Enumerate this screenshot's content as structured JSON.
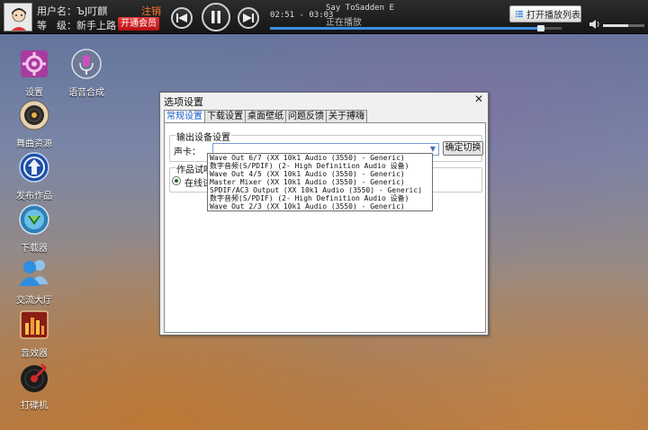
{
  "top_bar": {
    "username_label": "用户名：",
    "username": "ЪJ叮麒",
    "level_label": "等　级：",
    "level": "新手上路",
    "logout": "注销",
    "vip_button": "开通会员",
    "time_current": "02:51",
    "time_separator": " - ",
    "time_total": "03:03",
    "song_title": "Say ToSadden E",
    "play_status": "正在播放",
    "progress_fraction": 0.94,
    "playlist_button": "打开播放列表",
    "volume_fraction": 0.6,
    "colors": {
      "accent": "#3d8fe0",
      "vip": "#d42426",
      "logout": "#ff7a2a"
    }
  },
  "desktop_icons": [
    {
      "label": "设置",
      "icon": "settings-icon"
    },
    {
      "label": "语音合成",
      "icon": "microphone-icon"
    },
    {
      "label": "舞曲资源",
      "icon": "vinyl-disc-icon"
    },
    {
      "label": "发布作品",
      "icon": "upload-icon"
    },
    {
      "label": "下载器",
      "icon": "download-icon"
    },
    {
      "label": "交流大厅",
      "icon": "chat-people-icon"
    },
    {
      "label": "音效器",
      "icon": "equalizer-icon"
    },
    {
      "label": "打碟机",
      "icon": "turntable-icon"
    }
  ],
  "dialog": {
    "title": "选项设置",
    "close": "✕",
    "tabs": [
      "常规设置",
      "下载设置",
      "桌面壁纸",
      "问题反馈",
      "关于搏嗨"
    ],
    "output_group_title": "输出设备设置",
    "soundcard_label": "声卡：",
    "combo_value": "",
    "confirm_button": "确定切换",
    "preview_group_title": "作品试听模",
    "radio_label": "在线试听",
    "dropdown_options": [
      "Wave Out 6/7 (XX 10k1 Audio (3550) - Generic)",
      "数字音频(S/PDIF) (2- High Definition Audio 设备)",
      "Wave Out 4/5 (XX 10k1 Audio (3550) - Generic)",
      "Master Mixer (XX 10k1 Audio (3550) - Generic)",
      "SPDIF/AC3 Output (XX 10k1 Audio (3550) - Generic)",
      "数字音频(S/PDIF) (2- High Definition Audio 设备)",
      "Wave Out 2/3 (XX 10k1 Audio (3550) - Generic)"
    ]
  }
}
